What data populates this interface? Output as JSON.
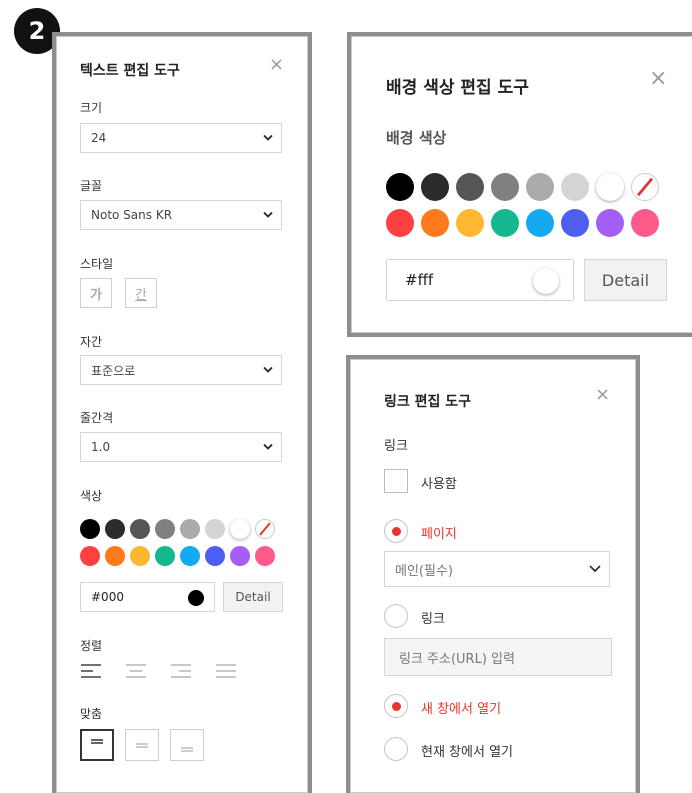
{
  "step_badge": "2",
  "text_tool": {
    "title": "텍스트 편집 도구",
    "close": "×",
    "size_label": "크기",
    "size_value": "24",
    "font_label": "글꼴",
    "font_value": "Noto Sans KR",
    "style_label": "스타일",
    "style_buttons": [
      "가",
      "간"
    ],
    "spacing_label": "자간",
    "spacing_value": "표준으로",
    "line_label": "줄간격",
    "line_value": "1.0",
    "color_label": "색상",
    "color_value": "#000",
    "detail": "Detail",
    "align_label": "정렬",
    "valign_label": "맞춤"
  },
  "bg_tool": {
    "title": "배경 색상 편집 도구",
    "close": "×",
    "color_label": "배경 색상",
    "color_value": "#fff",
    "detail": "Detail"
  },
  "palette": {
    "row1": [
      "#000000",
      "#2b2b2b",
      "#555555",
      "#808080",
      "#aaaaaa",
      "#d4d4d4",
      "#ffffff",
      "none"
    ],
    "row2": [
      "#ff4040",
      "#ff7a1a",
      "#ffb732",
      "#14b88e",
      "#15a9f0",
      "#4d5ef0",
      "#a35ff5",
      "#ff5a8c"
    ]
  },
  "link_tool": {
    "title": "링크 편집 도구",
    "close": "×",
    "link_label": "링크",
    "use_label": "사용함",
    "page_option": "페이지",
    "page_select": "메인(필수)",
    "link_option": "링크",
    "url_placeholder": "링크 주소(URL) 입력",
    "new_window": "새 창에서 열기",
    "current_window": "현재 창에서 열기"
  },
  "icons": {
    "close": "close-icon",
    "chevron": "chevron-down-icon",
    "align_left": "align-left-icon",
    "align_center": "align-center-icon",
    "align_right": "align-right-icon",
    "align_justify": "align-justify-icon",
    "valign_top": "valign-top-icon",
    "valign_middle": "valign-middle-icon",
    "valign_bottom": "valign-bottom-icon"
  },
  "accent_color": "#e8342f"
}
